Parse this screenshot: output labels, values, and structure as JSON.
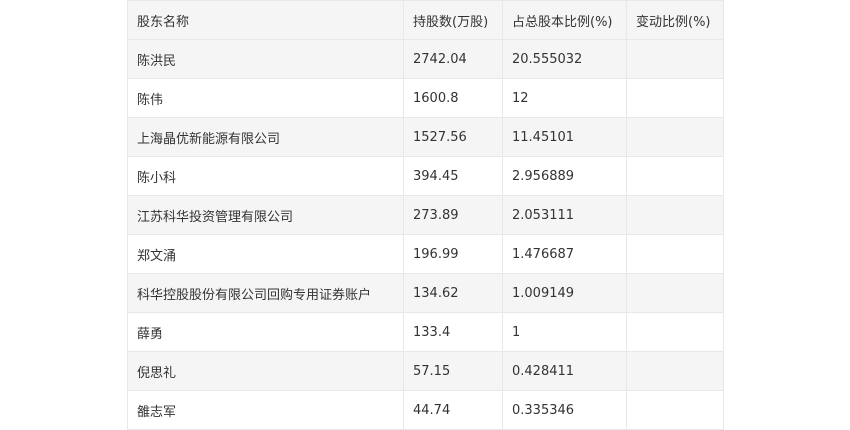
{
  "table": {
    "headers": [
      "股东名称",
      "持股数(万股)",
      "占总股本比例(%)",
      "变动比例(%)"
    ],
    "rows": [
      {
        "name": "陈洪民",
        "shares": "2742.04",
        "ratio": "20.555032",
        "change": ""
      },
      {
        "name": "陈伟",
        "shares": "1600.8",
        "ratio": "12",
        "change": ""
      },
      {
        "name": "上海晶优新能源有限公司",
        "shares": "1527.56",
        "ratio": "11.45101",
        "change": ""
      },
      {
        "name": "陈小科",
        "shares": "394.45",
        "ratio": "2.956889",
        "change": ""
      },
      {
        "name": "江苏科华投资管理有限公司",
        "shares": "273.89",
        "ratio": "2.053111",
        "change": ""
      },
      {
        "name": "郑文涌",
        "shares": "196.99",
        "ratio": "1.476687",
        "change": ""
      },
      {
        "name": "科华控股股份有限公司回购专用证券账户",
        "shares": "134.62",
        "ratio": "1.009149",
        "change": ""
      },
      {
        "name": "薛勇",
        "shares": "133.4",
        "ratio": "1",
        "change": ""
      },
      {
        "name": "倪思礼",
        "shares": "57.15",
        "ratio": "0.428411",
        "change": ""
      },
      {
        "name": "雒志军",
        "shares": "44.74",
        "ratio": "0.335346",
        "change": ""
      }
    ]
  }
}
